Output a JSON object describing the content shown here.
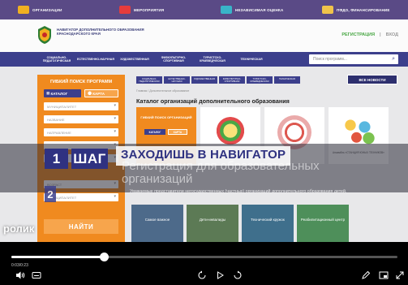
{
  "topstrip": {
    "items": [
      {
        "label": "ОРГАНИЗАЦИИ",
        "color": "#f0b021"
      },
      {
        "label": "МЕРОПРИЯТИЯ",
        "color": "#e63c3c"
      },
      {
        "label": "НЕЗАВИСИМАЯ ОЦЕНКА",
        "color": "#39b4c8"
      },
      {
        "label": "ПФДО, ФИНАНСИРОВАНИЕ",
        "color": "#f0c34a"
      }
    ]
  },
  "header": {
    "org_name": "НАВИГАТОР ДОПОЛНИТЕЛЬНОГО ОБРАЗОВАНИЯ КРАСНОДАРСКОГО КРАЯ",
    "register": "РЕГИСТРАЦИЯ",
    "separator": "|",
    "login": "ВХОД"
  },
  "nav": {
    "items": [
      "СОЦИАЛЬНО-ПЕДАГОГИЧЕСКАЯ",
      "ЕСТЕСТВЕННО-НАУЧНАЯ",
      "ХУДОЖЕСТВЕННАЯ",
      "ФИЗКУЛЬТУРНО-СПОРТИВНАЯ",
      "ТУРИСТСКО-КРАЕВЕДЧЕСКАЯ",
      "ТЕХНИЧЕСКАЯ"
    ],
    "search_placeholder": "Поиск программ..."
  },
  "sidebar": {
    "title": "ГИБКИЙ ПОИСК ПРОГРАММ",
    "catalog": "КАТАЛОГ",
    "map": "КАРТА",
    "selects": [
      "МУНИЦИПАЛИТЕТ",
      "НАЗВАНИЕ",
      "НАПРАВЛЕНИЕ",
      "",
      "",
      "ВОЗРАСТ",
      "МУНИЦИПАЛИТЕТ"
    ],
    "find": "НАЙТИ"
  },
  "main": {
    "tabs": [
      "СОЦИАЛЬНО-ПЕДАГОГИЧЕСКАЯ",
      "ЕСТЕСТВЕННО-НАУЧНАЯ",
      "ХУДОЖЕСТВЕННАЯ",
      "ФИЗКУЛЬТУРНО-СПОРТИВНАЯ",
      "ТУРИСТСКО-КРАЕВЕДЧЕСКАЯ",
      "ТЕХНИЧЕСКАЯ"
    ],
    "all_news": "ВСЕ НОВОСТИ",
    "breadcrumb": "Главная / Дополнительное образование",
    "catalog_title": "Каталог организаций дополнительного образования",
    "orange_card_title": "ГИБКИЙ ПОИСК ОРГАНИЗАЦИЙ",
    "orange_card_btn1": "КАТАЛОГ",
    "orange_card_btn2": "КАРТА",
    "card3_caption": "Ансамбль «СТАНЦИЯ ЮНЫХ ТЕХНИКОВ»",
    "description": "Уважаемые представители негосударственных (частных) организаций дополнительного образования детей.",
    "bottom_tiles": [
      "Самое важное",
      "Дети-инвалиды",
      "Технический кружок",
      "Реабилитационный центр"
    ]
  },
  "overlay": {
    "step_number": "1",
    "step_label": "ШАГ",
    "slogan": "ЗАХОДИШЬ В НАВИГАТОР",
    "ghost_text": "Регистрация для образовательных организаций",
    "step2_number": "2",
    "caption": "ролик"
  },
  "player": {
    "time": "0:03/0:23",
    "progress": 0.24,
    "accent": "#2f3281"
  }
}
